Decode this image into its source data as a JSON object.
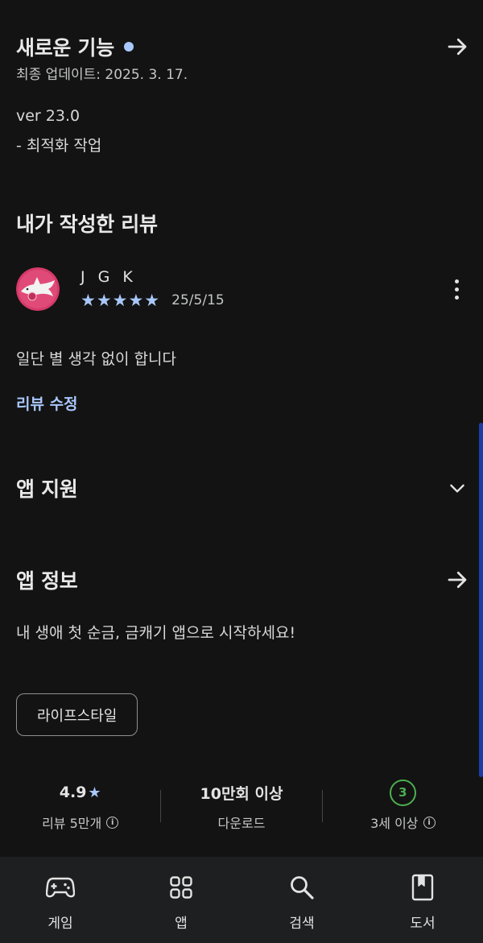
{
  "whats_new": {
    "title": "새로운 기능",
    "last_updated": "최종 업데이트: 2025. 3. 17.",
    "version": "ver 23.0",
    "notes": "- 최적화 작업"
  },
  "my_review": {
    "title": "내가 작성한 리뷰",
    "reviewer_name": "J G K",
    "stars": "★★★★★",
    "rating": 5,
    "date": "25/5/15",
    "text": "일단 별 생각 없이 합니다",
    "edit_label": "리뷰 수정"
  },
  "app_support": {
    "title": "앱 지원"
  },
  "app_info": {
    "title": "앱 정보",
    "description": "내 생애 첫 순금, 금캐기 앱으로 시작하세요!",
    "category_chip": "라이프스타일"
  },
  "stats": {
    "rating_value": "4.9",
    "rating_star": "★",
    "rating_label": "리뷰 5만개",
    "downloads_value": "10만회 이상",
    "downloads_label": "다운로드",
    "age_value": "3",
    "age_label": "3세 이상"
  },
  "bottom_nav": {
    "items": [
      {
        "label": "게임",
        "icon": "gamepad-icon"
      },
      {
        "label": "앱",
        "icon": "apps-grid-icon"
      },
      {
        "label": "검색",
        "icon": "search-icon"
      },
      {
        "label": "도서",
        "icon": "book-icon"
      }
    ]
  },
  "colors": {
    "background": "#131313",
    "accent": "#a8c7fa",
    "age_badge": "#4caf50",
    "nav_background": "#1e1f20"
  }
}
